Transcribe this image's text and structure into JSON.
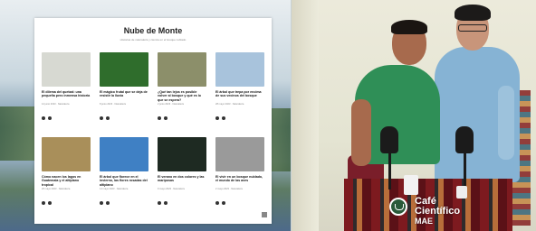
{
  "website": {
    "title": "Nube de Monte",
    "subtitle": "Historias de naturaleza y ciencia en el bosque nublado",
    "cards": [
      {
        "title": "El dilema del quetzal: una pequeña pero inmensa historia",
        "meta": "12 junio 2023 · Naturaleza",
        "thumb": "#d7d9d2"
      },
      {
        "title": "El mágico frutal que se deja de resistir la lluvia",
        "meta": "8 junio 2023 · Naturaleza",
        "thumb": "#2f6d2c"
      },
      {
        "title": "¿Qué tan lejos es posible volver al bosque y qué es lo que se espera?",
        "meta": "2 junio 2023 · Naturaleza",
        "thumb": "#8c8f6a"
      },
      {
        "title": "El árbol que trepa por encima de sus vecinos del bosque",
        "meta": "28 mayo 2023 · Naturaleza",
        "thumb": "#a8c3dc"
      },
      {
        "title": "Cómo nacen los lagos en Guatemala y el altiplano tropical",
        "meta": "20 mayo 2023 · Naturaleza",
        "thumb": "#a98f5a"
      },
      {
        "title": "El árbol que florece en el invierno, las flores rosadas del altiplano",
        "meta": "14 mayo 2023 · Naturaleza",
        "thumb": "#3f80c4"
      },
      {
        "title": "El verano en dos colores y las mariposas",
        "meta": "9 mayo 2023 · Naturaleza",
        "thumb": "#1e2a22"
      },
      {
        "title": "El vivir en un bosque nublado, el mundo de las aves",
        "meta": "2 mayo 2023 · Naturaleza",
        "thumb": "#9a9a9a"
      }
    ]
  },
  "logo": {
    "line1": "Café",
    "line2": "Científico",
    "line3": "MAE"
  }
}
